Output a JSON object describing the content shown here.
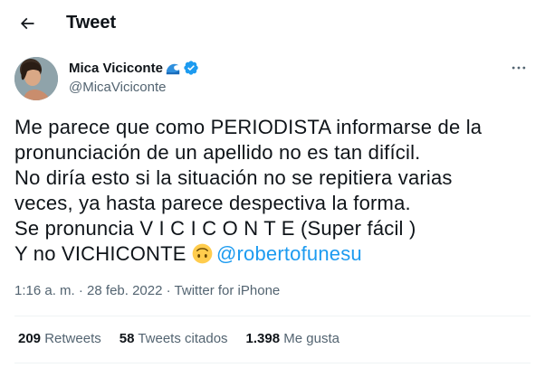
{
  "header": {
    "title": "Tweet",
    "back_icon": "arrow-left-icon"
  },
  "author": {
    "display_name": "Mica Viciconte",
    "handle": "@MicaViciconte",
    "badges": [
      "wave-emoji-icon",
      "verified-badge-icon"
    ],
    "verified_color": "#1d9bf0"
  },
  "more_icon": "more-horizontal-icon",
  "tweet": {
    "line1": "Me parece que como PERIODISTA informarse de la",
    "line2": "pronunciación de un apellido no es tan difícil.",
    "line3": "No diría esto si la situación no se repitiera varias",
    "line4": "veces, ya hasta parece despectiva la forma.",
    "line5": "Se pronuncia V I C I C O N T E (Super fácil )",
    "line6_prefix": "Y no VICHICONTE ",
    "line6_emoji": "upside-down-face-emoji",
    "mention": "@robertofunesu",
    "mention_color": "#1d9bf0"
  },
  "meta": {
    "time": "1:16 a. m.",
    "separator1": " · ",
    "date": "28 feb. 2022",
    "separator2": " · ",
    "source": "Twitter for iPhone"
  },
  "stats": [
    {
      "count": "209",
      "label": "Retweets"
    },
    {
      "count": "58",
      "label": "Tweets citados"
    },
    {
      "count": "1.398",
      "label": "Me gusta"
    }
  ]
}
